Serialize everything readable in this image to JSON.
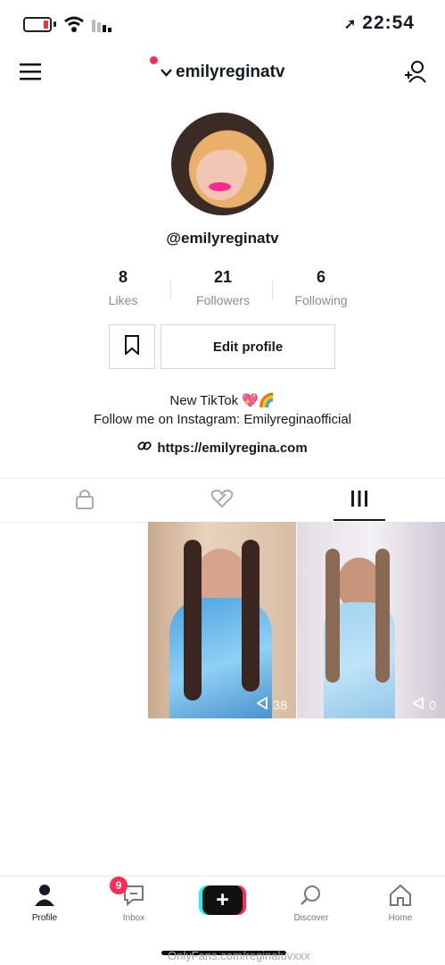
{
  "status": {
    "time": "22:54",
    "icons": [
      "battery-icon",
      "wifi-icon",
      "cellular-icon",
      "location-arrow-icon"
    ]
  },
  "header": {
    "username": "emilyreginatv",
    "icons": [
      "menu-icon",
      "chevron-down-icon",
      "add-user-icon"
    ]
  },
  "profile": {
    "handle": "@emilyreginatv",
    "stats": [
      {
        "value": "8",
        "label": "Likes"
      },
      {
        "value": "21",
        "label": "Followers"
      },
      {
        "value": "6",
        "label": "Following"
      }
    ],
    "edit_label": "Edit profile",
    "bio_line1": "New TikTok 💖🌈",
    "bio_line2": "Follow me on Instagram: Emilyreginaofficial",
    "link": "https://emilyregina.com"
  },
  "tabs": [
    {
      "icon": "lock-icon"
    },
    {
      "icon": "liked-heart-icon"
    },
    {
      "icon": "grid-icon",
      "active": true
    }
  ],
  "videos": [
    {
      "views": "38",
      "icon": "play-icon"
    },
    {
      "views": "0",
      "icon": "play-icon"
    }
  ],
  "nav": {
    "items": [
      "Profile",
      "Inbox",
      "Discover",
      "Home"
    ],
    "inbox_badge": "9"
  },
  "watermark": "OnlyFans.com/reginaluvxxx",
  "colors": {
    "accent": "#fe2c55",
    "cyan": "#25f4ee",
    "text": "#161823"
  }
}
